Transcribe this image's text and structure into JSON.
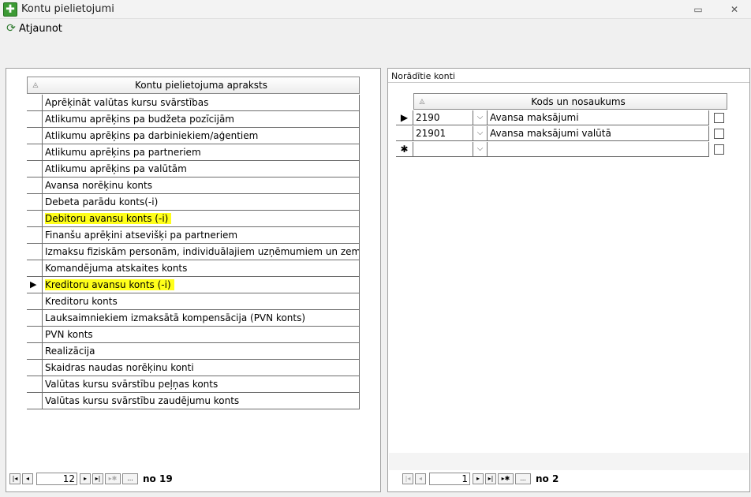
{
  "window": {
    "title": "Kontu pielietojumi",
    "minimize_glyph": "▭",
    "close_glyph": "✕"
  },
  "toolbar": {
    "refresh_label": "Atjaunot",
    "refresh_icon": "refresh-icon"
  },
  "left_grid": {
    "sort_glyph": "◬",
    "header": "Kontu pielietojuma apraksts",
    "selected_index": 11,
    "rows": [
      "Aprēķināt valūtas kursu svārstības",
      "Atlikumu aprēķins pa budžeta pozīcijām",
      "Atlikumu aprēķins pa darbiniekiem/aģentiem",
      "Atlikumu aprēķins pa partneriem",
      "Atlikumu aprēķins pa valūtām",
      "Avansa norēķinu konts",
      "Debeta parādu konts(-i)",
      "Debitoru avansu konts (-i)",
      "Finanšu aprēķini atsevišķi pa partneriem",
      "Izmaksu fiziskām personām, individuālajiem uzņēmumiem un zem",
      "Komandējuma atskaites konts",
      "Kreditoru avansu konts (-i)",
      "Kreditoru konts",
      "Lauksaimniekiem izmaksātā kompensācija (PVN konts)",
      "PVN konts",
      "Realizācija",
      "Skaidras naudas norēķinu konti",
      "Valūtas kursu svārstību peļņas konts",
      "Valūtas kursu svārstību zaudējumu konts"
    ],
    "highlighted": [
      7,
      11
    ],
    "nav": {
      "position": "12",
      "total_label": "no 19"
    }
  },
  "right_panel": {
    "caption": "Norādītie konti",
    "sort_glyph": "◬",
    "header": "Kods un nosaukums",
    "rows": [
      {
        "code": "2190",
        "name": "Avansa maksājumi",
        "checked": false
      },
      {
        "code": "21901",
        "name": "Avansa maksājumi valūtā",
        "checked": false
      },
      {
        "code": "",
        "name": "",
        "checked": false
      }
    ],
    "new_row_glyph": "✱",
    "nav": {
      "position": "1",
      "total_label": "no 2"
    }
  },
  "nav_glyphs": {
    "first": "|◂",
    "prev": "◂",
    "next": "▸",
    "last": "▸|",
    "new": "▸✱",
    "more": "..."
  },
  "colors": {
    "highlight": "#ffff1a",
    "app_icon": "#3c9a34"
  }
}
